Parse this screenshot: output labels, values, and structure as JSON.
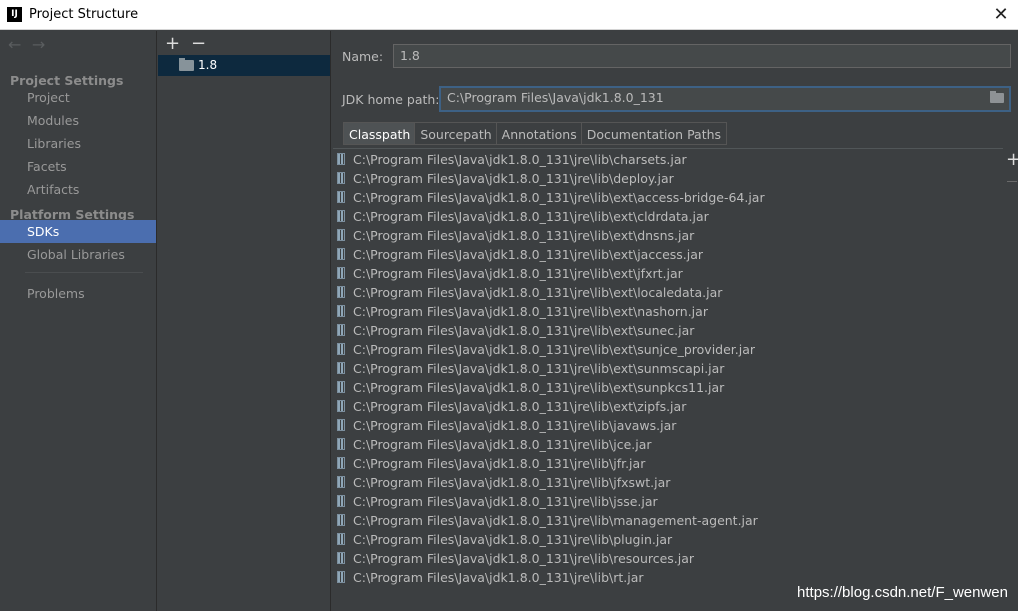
{
  "window": {
    "title": "Project Structure",
    "logo": "IJ"
  },
  "nav": {
    "back_arrow": "←",
    "forward_arrow": "→",
    "sections": [
      {
        "header": "Project Settings",
        "items": [
          "Project",
          "Modules",
          "Libraries",
          "Facets",
          "Artifacts"
        ]
      },
      {
        "header": "Platform Settings",
        "items": [
          "SDKs",
          "Global Libraries"
        ]
      }
    ],
    "problems": "Problems"
  },
  "sdk_list": {
    "add": "+",
    "remove": "−",
    "items": [
      "1.8"
    ]
  },
  "form": {
    "name_label": "Name:",
    "name_value": "1.8",
    "jdk_label": "JDK home path:",
    "jdk_value": "C:\\Program Files\\Java\\jdk1.8.0_131"
  },
  "tabs": [
    "Classpath",
    "Sourcepath",
    "Annotations",
    "Documentation Paths"
  ],
  "classpath": [
    "C:\\Program Files\\Java\\jdk1.8.0_131\\jre\\lib\\charsets.jar",
    "C:\\Program Files\\Java\\jdk1.8.0_131\\jre\\lib\\deploy.jar",
    "C:\\Program Files\\Java\\jdk1.8.0_131\\jre\\lib\\ext\\access-bridge-64.jar",
    "C:\\Program Files\\Java\\jdk1.8.0_131\\jre\\lib\\ext\\cldrdata.jar",
    "C:\\Program Files\\Java\\jdk1.8.0_131\\jre\\lib\\ext\\dnsns.jar",
    "C:\\Program Files\\Java\\jdk1.8.0_131\\jre\\lib\\ext\\jaccess.jar",
    "C:\\Program Files\\Java\\jdk1.8.0_131\\jre\\lib\\ext\\jfxrt.jar",
    "C:\\Program Files\\Java\\jdk1.8.0_131\\jre\\lib\\ext\\localedata.jar",
    "C:\\Program Files\\Java\\jdk1.8.0_131\\jre\\lib\\ext\\nashorn.jar",
    "C:\\Program Files\\Java\\jdk1.8.0_131\\jre\\lib\\ext\\sunec.jar",
    "C:\\Program Files\\Java\\jdk1.8.0_131\\jre\\lib\\ext\\sunjce_provider.jar",
    "C:\\Program Files\\Java\\jdk1.8.0_131\\jre\\lib\\ext\\sunmscapi.jar",
    "C:\\Program Files\\Java\\jdk1.8.0_131\\jre\\lib\\ext\\sunpkcs11.jar",
    "C:\\Program Files\\Java\\jdk1.8.0_131\\jre\\lib\\ext\\zipfs.jar",
    "C:\\Program Files\\Java\\jdk1.8.0_131\\jre\\lib\\javaws.jar",
    "C:\\Program Files\\Java\\jdk1.8.0_131\\jre\\lib\\jce.jar",
    "C:\\Program Files\\Java\\jdk1.8.0_131\\jre\\lib\\jfr.jar",
    "C:\\Program Files\\Java\\jdk1.8.0_131\\jre\\lib\\jfxswt.jar",
    "C:\\Program Files\\Java\\jdk1.8.0_131\\jre\\lib\\jsse.jar",
    "C:\\Program Files\\Java\\jdk1.8.0_131\\jre\\lib\\management-agent.jar",
    "C:\\Program Files\\Java\\jdk1.8.0_131\\jre\\lib\\plugin.jar",
    "C:\\Program Files\\Java\\jdk1.8.0_131\\jre\\lib\\resources.jar",
    "C:\\Program Files\\Java\\jdk1.8.0_131\\jre\\lib\\rt.jar"
  ],
  "side_add": "+",
  "watermark": "https://blog.csdn.net/F_wenwen",
  "colors": {
    "selection": "#4b6eaf",
    "background": "#3c3f41",
    "sdk_selected": "#0d293e"
  }
}
